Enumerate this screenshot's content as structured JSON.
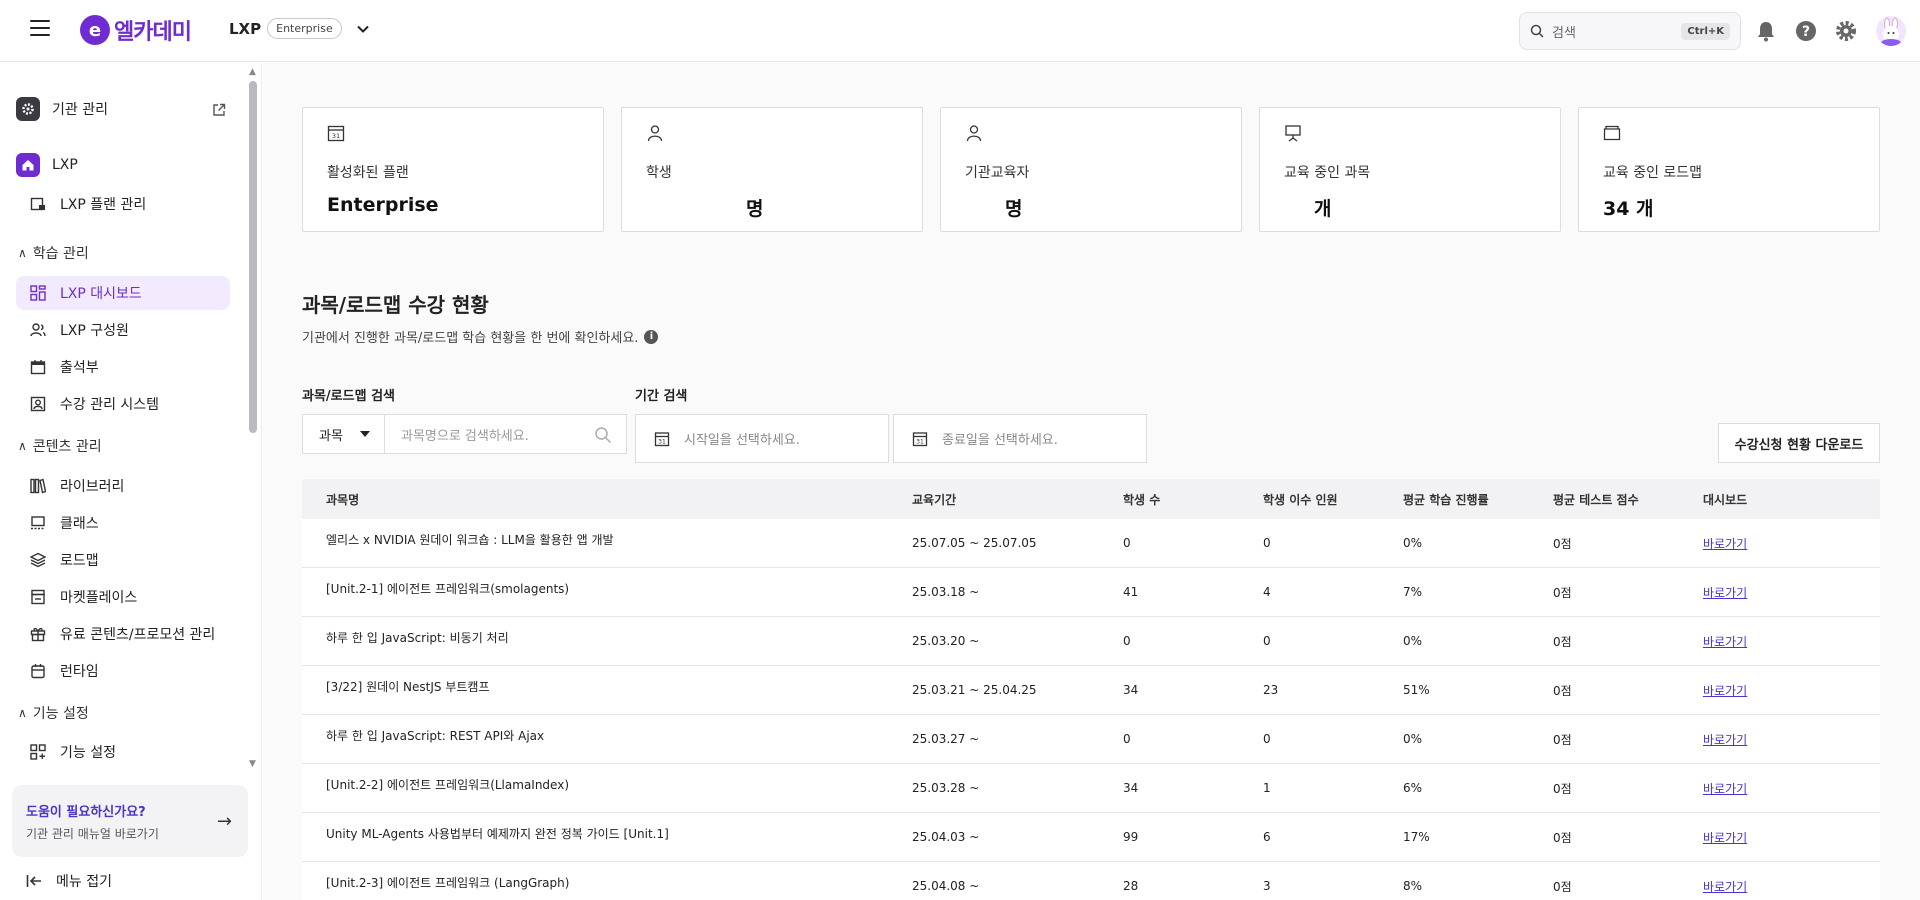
{
  "header": {
    "logo_mark": "e",
    "logo_text": "엘카데미",
    "product_name": "LXP",
    "product_badge": "Enterprise",
    "search_placeholder": "검색",
    "search_shortcut": "Ctrl+K",
    "accent": "#6f2dd1"
  },
  "sidebar": {
    "org_admin": "기관 관리",
    "lxp": "LXP",
    "lxp_plan": "LXP 플랜 관리",
    "section_learning": "학습 관리",
    "learning_items": [
      {
        "label": "LXP 대시보드",
        "icon": "dashboard-icon",
        "active": true
      },
      {
        "label": "LXP 구성원",
        "icon": "members-icon"
      },
      {
        "label": "출석부",
        "icon": "calendar-icon"
      },
      {
        "label": "수강 관리 시스템",
        "icon": "user-card-icon"
      }
    ],
    "section_content": "콘텐츠 관리",
    "content_items": [
      {
        "label": "라이브러리",
        "icon": "library-icon"
      },
      {
        "label": "클래스",
        "icon": "class-icon"
      },
      {
        "label": "로드맵",
        "icon": "layers-icon"
      },
      {
        "label": "마켓플레이스",
        "icon": "marketplace-icon"
      },
      {
        "label": "유료 콘텐츠/프로모션 관리",
        "icon": "gift-icon"
      },
      {
        "label": "런타임",
        "icon": "runtime-icon"
      }
    ],
    "section_features": "기능 설정",
    "feature_items": [
      {
        "label": "기능 설정",
        "icon": "grid-plus-icon"
      }
    ],
    "help_title": "도움이 필요하신가요?",
    "help_sub": "기관 관리 매뉴얼 바로가기",
    "collapse": "메뉴 접기"
  },
  "stats": [
    {
      "label": "활성화된 플랜",
      "value": "Enterprise",
      "icon": "calendar-31-icon"
    },
    {
      "label": "학생",
      "value": "명",
      "icon": "person-icon"
    },
    {
      "label": "기관교육자",
      "value": "명",
      "icon": "person-icon"
    },
    {
      "label": "교육 중인 과목",
      "value": "개",
      "icon": "presentation-icon"
    },
    {
      "label": "교육 중인 로드맵",
      "value": "34 개",
      "icon": "folder-icon"
    }
  ],
  "section": {
    "title": "과목/로드맵 수강 현황",
    "desc": "기관에서 진행한 과목/로드맵 학습 현황을 한 번에 확인하세요.",
    "search_label": "과목/로드맵 검색",
    "period_label": "기간 검색",
    "select_value": "과목",
    "search_placeholder": "과목명으로 검색하세요.",
    "start_placeholder": "시작일을 선택하세요.",
    "end_placeholder": "종료일을 선택하세요.",
    "download_label": "수강신청 현황 다운로드"
  },
  "table": {
    "headers": [
      "과목명",
      "교육기간",
      "학생 수",
      "학생 이수 인원",
      "평균 학습 진행률",
      "평균 테스트 점수",
      "대시보드"
    ],
    "rows": [
      [
        "엘리스 x NVIDIA 원데이 워크숍 : LLM을 활용한 앱 개발",
        "25.07.05 ~ 25.07.05",
        "0",
        "0",
        "0%",
        "0점",
        "바로가기"
      ],
      [
        "[Unit.2-1] 에이전트 프레임워크(smolagents)",
        "25.03.18 ~",
        "41",
        "4",
        "7%",
        "0점",
        "바로가기"
      ],
      [
        "하루 한 입 JavaScript: 비동기 처리",
        "25.03.20 ~",
        "0",
        "0",
        "0%",
        "0점",
        "바로가기"
      ],
      [
        "[3/22] 원데이 NestJS 부트캠프",
        "25.03.21 ~ 25.04.25",
        "34",
        "23",
        "51%",
        "0점",
        "바로가기"
      ],
      [
        "하루 한 입 JavaScript: REST API와 Ajax",
        "25.03.27 ~",
        "0",
        "0",
        "0%",
        "0점",
        "바로가기"
      ],
      [
        "[Unit.2-2] 에이전트 프레임워크(LlamaIndex)",
        "25.03.28 ~",
        "34",
        "1",
        "6%",
        "0점",
        "바로가기"
      ],
      [
        "Unity ML-Agents 사용법부터 예제까지 완전 정복 가이드 [Unit.1]",
        "25.04.03 ~",
        "99",
        "6",
        "17%",
        "0점",
        "바로가기"
      ],
      [
        "[Unit.2-3] 에이전트 프레임워크 (LangGraph)",
        "25.04.08 ~",
        "28",
        "3",
        "8%",
        "0점",
        "바로가기"
      ]
    ]
  }
}
